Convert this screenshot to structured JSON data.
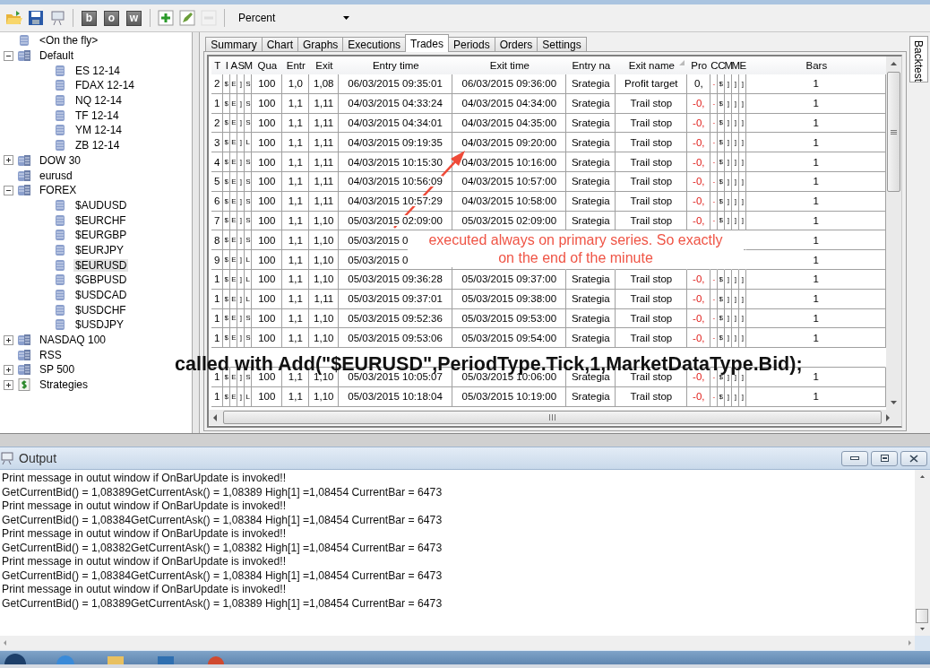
{
  "toolbar": {
    "letter_buttons": [
      "b",
      "o",
      "w"
    ],
    "edit_buttons": [
      {
        "kind": "add",
        "disabled": false
      },
      {
        "kind": "edit",
        "disabled": false
      },
      {
        "kind": "remove",
        "disabled": true
      }
    ],
    "dropdown": {
      "value": "Percent"
    }
  },
  "tree": [
    {
      "label": "<On the fly>",
      "kind": "instrument",
      "selected": false
    },
    {
      "label": "Default",
      "kind": "list",
      "expanded": true,
      "selected": false,
      "children": [
        {
          "label": "ES 12-14",
          "kind": "instrument",
          "selected": false
        },
        {
          "label": "FDAX 12-14",
          "kind": "instrument",
          "selected": false
        },
        {
          "label": "NQ 12-14",
          "kind": "instrument",
          "selected": false
        },
        {
          "label": "TF 12-14",
          "kind": "instrument",
          "selected": false
        },
        {
          "label": "YM 12-14",
          "kind": "instrument",
          "selected": false
        },
        {
          "label": "ZB 12-14",
          "kind": "instrument",
          "selected": false
        }
      ]
    },
    {
      "label": "DOW 30",
      "kind": "list",
      "expanded": false,
      "selected": false
    },
    {
      "label": "eurusd",
      "kind": "list",
      "selected": false
    },
    {
      "label": "FOREX",
      "kind": "list",
      "expanded": true,
      "selected": false,
      "children": [
        {
          "label": "$AUDUSD",
          "kind": "instrument",
          "selected": false
        },
        {
          "label": "$EURCHF",
          "kind": "instrument",
          "selected": false
        },
        {
          "label": "$EURGBP",
          "kind": "instrument",
          "selected": false
        },
        {
          "label": "$EURJPY",
          "kind": "instrument",
          "selected": false
        },
        {
          "label": "$EURUSD",
          "kind": "instrument",
          "selected": true
        },
        {
          "label": "$GBPUSD",
          "kind": "instrument",
          "selected": false
        },
        {
          "label": "$USDCAD",
          "kind": "instrument",
          "selected": false
        },
        {
          "label": "$USDCHF",
          "kind": "instrument",
          "selected": false
        },
        {
          "label": "$USDJPY",
          "kind": "instrument",
          "selected": false
        }
      ]
    },
    {
      "label": "NASDAQ 100",
      "kind": "list",
      "expanded": false,
      "selected": false
    },
    {
      "label": "RSS",
      "kind": "list",
      "selected": false
    },
    {
      "label": "SP 500",
      "kind": "list",
      "expanded": false,
      "selected": false
    },
    {
      "label": "Strategies",
      "kind": "strategy",
      "expanded": false,
      "selected": false
    }
  ],
  "tabs": [
    {
      "label": "Summary",
      "selected": false
    },
    {
      "label": "Chart",
      "selected": false
    },
    {
      "label": "Graphs",
      "selected": false
    },
    {
      "label": "Executions",
      "selected": false
    },
    {
      "label": "Trades",
      "selected": true
    },
    {
      "label": "Periods",
      "selected": false
    },
    {
      "label": "Orders",
      "selected": false
    },
    {
      "label": "Settings",
      "selected": false
    }
  ],
  "side_tab": {
    "label": "Backtest"
  },
  "table": {
    "columns": [
      {
        "label": "T",
        "sorted": false
      },
      {
        "label": "I",
        "sorted": false
      },
      {
        "label": "A",
        "sorted": false
      },
      {
        "label": "S",
        "sorted": false
      },
      {
        "label": "M",
        "sorted": false
      },
      {
        "label": "Qua",
        "sorted": false
      },
      {
        "label": "Entr",
        "sorted": false
      },
      {
        "label": "Exit",
        "sorted": false
      },
      {
        "label": "Entry time",
        "sorted": false
      },
      {
        "label": "Exit time",
        "sorted": false
      },
      {
        "label": "Entry na",
        "sorted": false
      },
      {
        "label": "Exit name",
        "sorted": true
      },
      {
        "label": "Pro",
        "sorted": false
      },
      {
        "label": "C",
        "sorted": false
      },
      {
        "label": "C",
        "sorted": false
      },
      {
        "label": "M",
        "sorted": false
      },
      {
        "label": "M",
        "sorted": false
      },
      {
        "label": "E",
        "sorted": false
      },
      {
        "label": "Bars",
        "sorted": false
      }
    ],
    "rows": [
      {
        "cells": [
          "2",
          "$",
          "E",
          "]",
          "S",
          "100",
          "1,0",
          "1,08",
          "06/03/2015 09:35:01",
          "06/03/2015 09:36:00",
          "Srategia",
          "Profit target",
          "0,",
          "-",
          "$",
          "]",
          "]",
          "]",
          "1"
        ],
        "loss": false
      },
      {
        "cells": [
          "1",
          "$",
          "E",
          "]",
          "S",
          "100",
          "1,1",
          "1,11",
          "04/03/2015 04:33:24",
          "04/03/2015 04:34:00",
          "Srategia",
          "Trail stop",
          "-0,",
          "-",
          "$",
          "]",
          "]",
          "]",
          "1"
        ],
        "loss": true
      },
      {
        "cells": [
          "2",
          "$",
          "E",
          "]",
          "S",
          "100",
          "1,1",
          "1,11",
          "04/03/2015 04:34:01",
          "04/03/2015 04:35:00",
          "Srategia",
          "Trail stop",
          "-0,",
          "-",
          "$",
          "]",
          "]",
          "]",
          "1"
        ],
        "loss": true
      },
      {
        "cells": [
          "3",
          "$",
          "E",
          "]",
          "L",
          "100",
          "1,1",
          "1,11",
          "04/03/2015 09:19:35",
          "04/03/2015 09:20:00",
          "Srategia",
          "Trail stop",
          "-0,",
          "-",
          "$",
          "]",
          "]",
          "]",
          "1"
        ],
        "loss": true
      },
      {
        "cells": [
          "4",
          "$",
          "E",
          "]",
          "S",
          "100",
          "1,1",
          "1,11",
          "04/03/2015 10:15:30",
          "04/03/2015 10:16:00",
          "Srategia",
          "Trail stop",
          "-0,",
          "-",
          "$",
          "]",
          "]",
          "]",
          "1"
        ],
        "loss": true
      },
      {
        "cells": [
          "5",
          "$",
          "E",
          "]",
          "S",
          "100",
          "1,1",
          "1,11",
          "04/03/2015 10:56:09",
          "04/03/2015 10:57:00",
          "Srategia",
          "Trail stop",
          "-0,",
          "-",
          "$",
          "]",
          "]",
          "]",
          "1"
        ],
        "loss": true
      },
      {
        "cells": [
          "6",
          "$",
          "E",
          "]",
          "S",
          "100",
          "1,1",
          "1,11",
          "04/03/2015 10:57:29",
          "04/03/2015 10:58:00",
          "Srategia",
          "Trail stop",
          "-0,",
          "-",
          "$",
          "]",
          "]",
          "]",
          "1"
        ],
        "loss": true
      },
      {
        "cells": [
          "7",
          "$",
          "E",
          "]",
          "S",
          "100",
          "1,1",
          "1,10",
          "05/03/2015 02:09:00",
          "05/03/2015 02:09:00",
          "Srategia",
          "Trail stop",
          "-0,",
          "-",
          "$",
          "]",
          "]",
          "]",
          "1"
        ],
        "loss": true
      },
      {
        "cells": [
          "8",
          "$",
          "E",
          "]",
          "S",
          "100",
          "1,1",
          "1,10",
          "05/03/2015 0",
          null,
          null,
          null,
          null,
          null,
          null,
          null,
          null,
          null,
          "1"
        ]
      },
      {
        "cells": [
          "9",
          "$",
          "E",
          "]",
          "L",
          "100",
          "1,1",
          "1,10",
          "05/03/2015 0",
          null,
          null,
          null,
          null,
          null,
          null,
          null,
          null,
          null,
          "1"
        ]
      },
      {
        "cells": [
          "1",
          "$",
          "E",
          "]",
          "L",
          "100",
          "1,1",
          "1,10",
          "05/03/2015 09:36:28",
          "05/03/2015 09:37:00",
          "Srategia",
          "Trail stop",
          "-0,",
          "-",
          "$",
          "]",
          "]",
          "]",
          "1"
        ],
        "loss": true
      },
      {
        "cells": [
          "1",
          "$",
          "E",
          "]",
          "L",
          "100",
          "1,1",
          "1,11",
          "05/03/2015 09:37:01",
          "05/03/2015 09:38:00",
          "Srategia",
          "Trail stop",
          "-0,",
          "-",
          "$",
          "]",
          "]",
          "]",
          "1"
        ],
        "loss": true
      },
      {
        "cells": [
          "1",
          "$",
          "E",
          "]",
          "S",
          "100",
          "1,1",
          "1,10",
          "05/03/2015 09:52:36",
          "05/03/2015 09:53:00",
          "Srategia",
          "Trail stop",
          "-0,",
          "-",
          "$",
          "]",
          "]",
          "]",
          "1"
        ],
        "loss": true
      },
      {
        "cells": [
          "1",
          "$",
          "E",
          "]",
          "S",
          "100",
          "1,1",
          "1,10",
          "05/03/2015 09:53:06",
          "05/03/2015 09:54:00",
          "Srategia",
          "Trail stop",
          "-0,",
          "-",
          "$",
          "]",
          "]",
          "]",
          "1"
        ],
        "loss": true
      },
      {
        "cells": [
          null,
          null,
          null,
          null,
          null,
          null,
          null,
          null,
          null,
          null,
          null,
          null,
          null,
          null,
          null,
          null,
          null,
          null,
          null
        ]
      },
      {
        "cells": [
          "1",
          "$",
          "E",
          "]",
          "S",
          "100",
          "1,1",
          "1,10",
          "05/03/2015 10:05:07",
          "05/03/2015 10:06:00",
          "Srategia",
          "Trail stop",
          "-0,",
          "-",
          "$",
          "]",
          "]",
          "]",
          "1"
        ],
        "loss": true
      },
      {
        "cells": [
          "1",
          "$",
          "E",
          "]",
          "L",
          "100",
          "1,1",
          "1,10",
          "05/03/2015 10:18:04",
          "05/03/2015 10:19:00",
          "Srategia",
          "Trail stop",
          "-0,",
          "-",
          "$",
          "]",
          "]",
          "]",
          "1"
        ],
        "loss": true
      }
    ]
  },
  "annotation": {
    "lines": [
      "executed always on primary series. So exactly",
      "on the end of the minute"
    ]
  },
  "overlay_caption": "called with Add(\"$EURUSD\",PeriodType.Tick,1,MarketDataType.Bid);",
  "output": {
    "title": "Output",
    "lines": [
      "Print message in outut window if OnBarUpdate is invoked!!",
      "GetCurrentBid() = 1,08389GetCurrentAsk() = 1,08389 High[1] =1,08454 CurrentBar = 6473",
      "Print message in outut window if OnBarUpdate is invoked!!",
      "GetCurrentBid() = 1,08384GetCurrentAsk() = 1,08384 High[1] =1,08454 CurrentBar = 6473",
      "Print message in outut window if OnBarUpdate is invoked!!",
      "GetCurrentBid() = 1,08382GetCurrentAsk() = 1,08382 High[1] =1,08454 CurrentBar = 6473",
      "Print message in outut window if OnBarUpdate is invoked!!",
      "GetCurrentBid() = 1,08384GetCurrentAsk() = 1,08384 High[1] =1,08454 CurrentBar = 6473",
      "Print message in outut window if OnBarUpdate is invoked!!",
      "GetCurrentBid() = 1,08389GetCurrentAsk() = 1,08389 High[1] =1,08454 CurrentBar = 6473"
    ]
  }
}
